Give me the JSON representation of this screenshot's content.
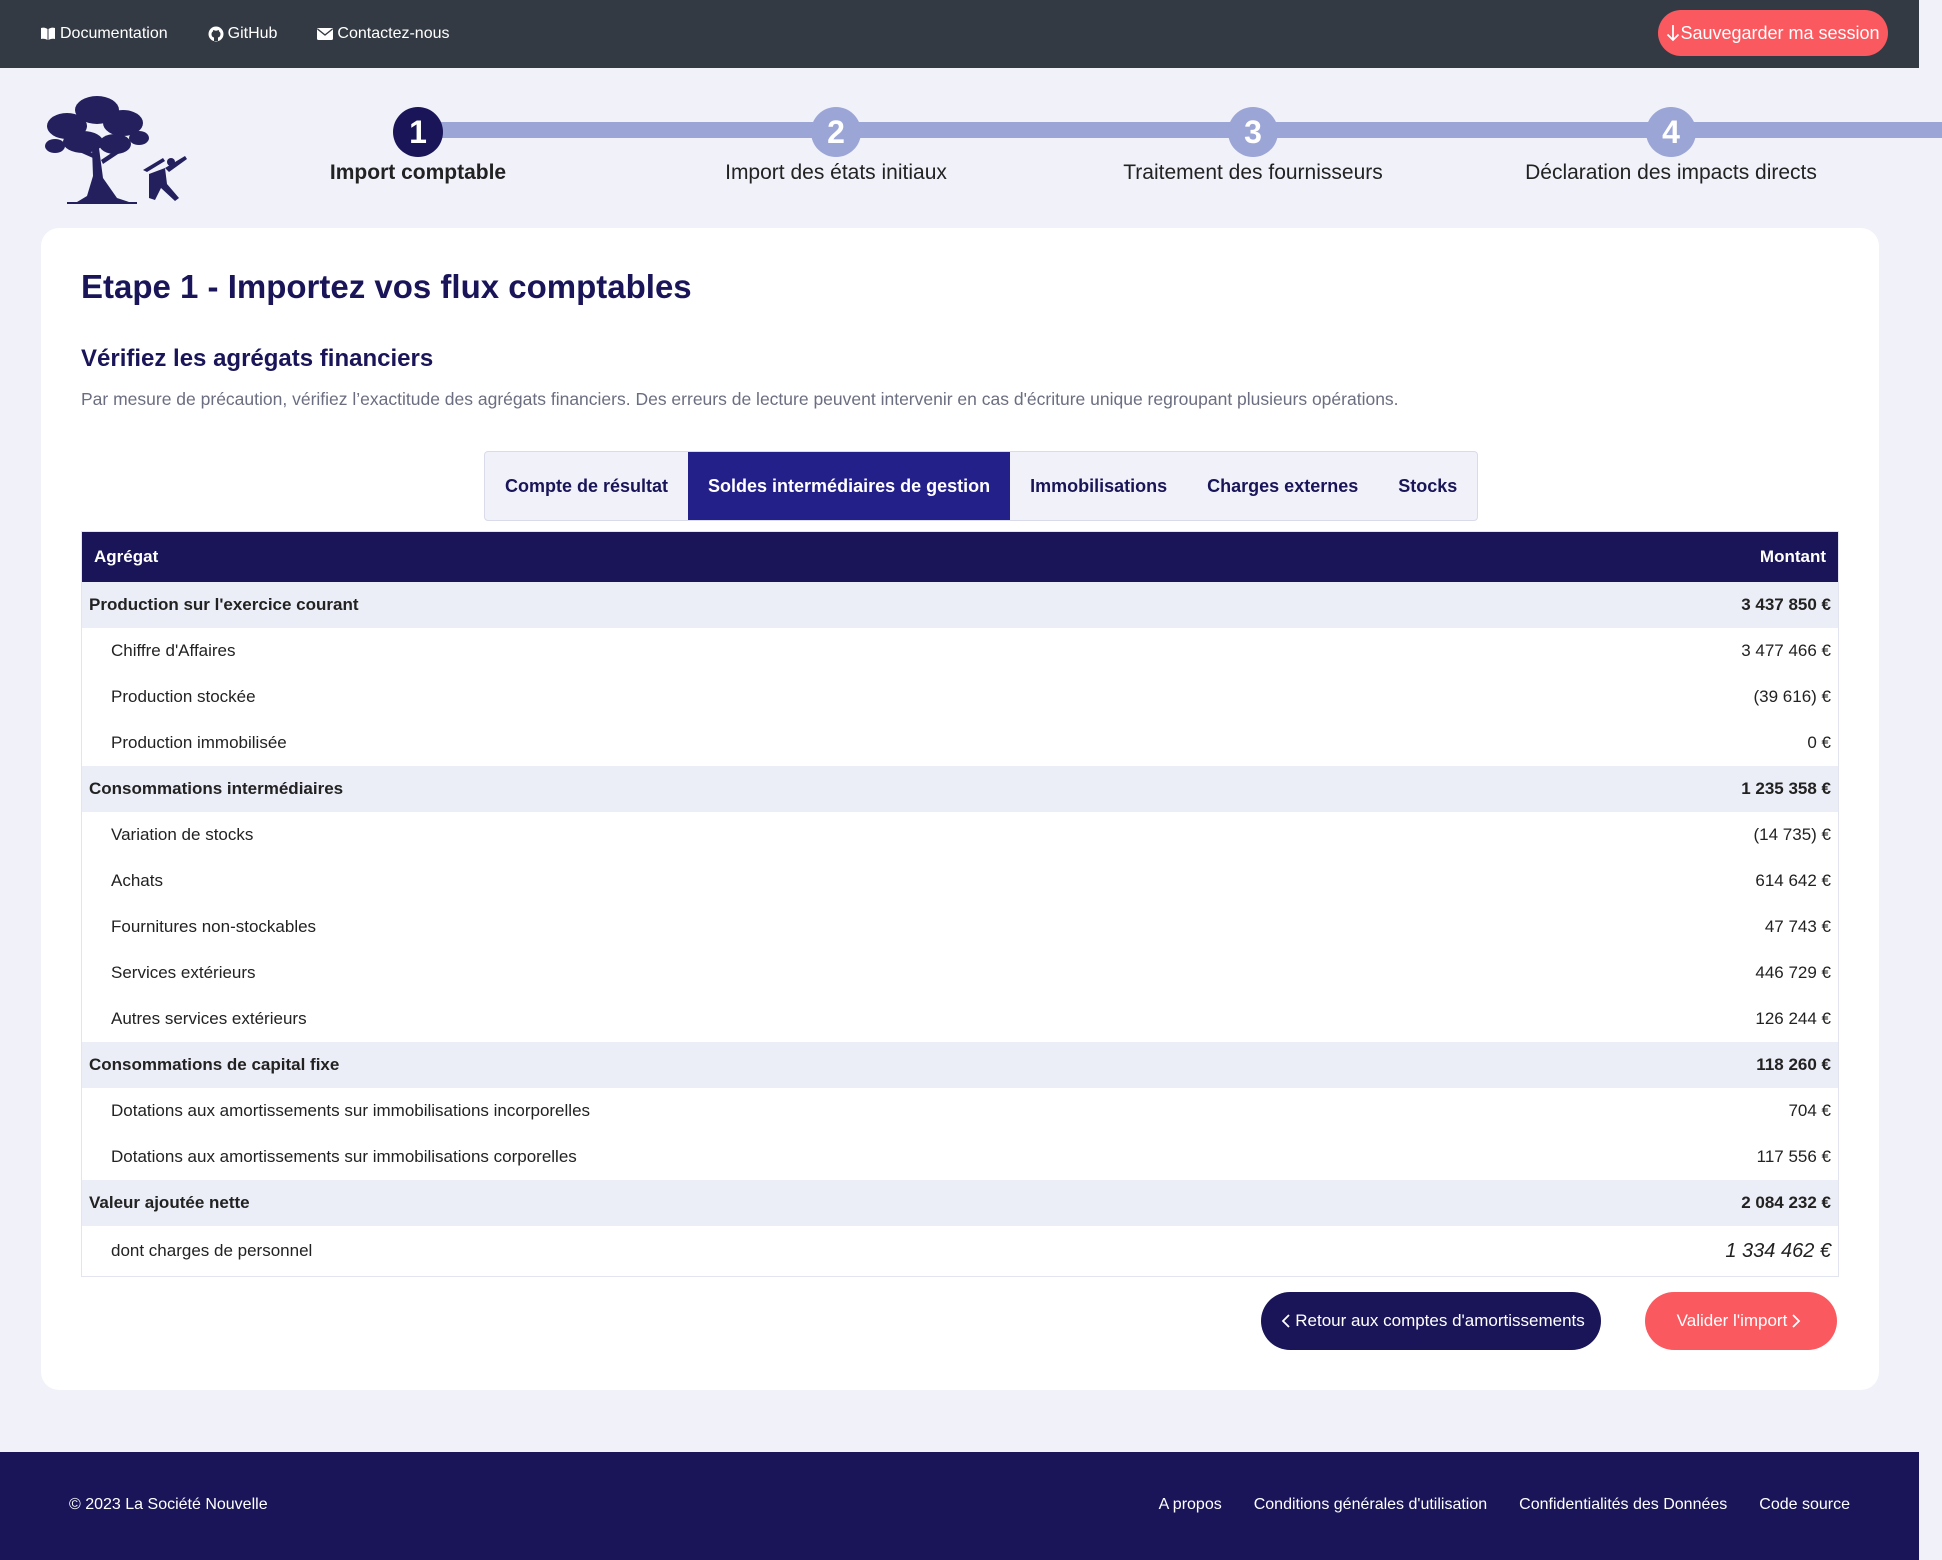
{
  "topbar": {
    "links": [
      {
        "label": "Documentation",
        "icon": "book-icon"
      },
      {
        "label": "GitHub",
        "icon": "github-icon"
      },
      {
        "label": "Contactez-nous",
        "icon": "envelope-icon"
      }
    ],
    "save_label": "Sauvegarder ma session"
  },
  "steps": [
    {
      "number": "1",
      "label": "Import comptable",
      "active": true
    },
    {
      "number": "2",
      "label": "Import des états initiaux",
      "active": false
    },
    {
      "number": "3",
      "label": "Traitement des fournisseurs",
      "active": false
    },
    {
      "number": "4",
      "label": "Déclaration des impacts directs",
      "active": false
    }
  ],
  "main": {
    "title": "Etape 1 - Importez vos flux comptables",
    "subtitle": "Vérifiez les agrégats financiers",
    "description": "Par mesure de précaution, vérifiez l’exactitude des agrégats financiers. Des erreurs de lecture peuvent intervenir en cas d'écriture unique regroupant plusieurs opérations.",
    "tabs": [
      {
        "label": "Compte de résultat",
        "active": false
      },
      {
        "label": "Soldes intermédiaires de gestion",
        "active": true
      },
      {
        "label": "Immobilisations",
        "active": false
      },
      {
        "label": "Charges externes",
        "active": false
      },
      {
        "label": "Stocks",
        "active": false
      }
    ],
    "table": {
      "headers": [
        "Agrégat",
        "Montant"
      ],
      "rows": [
        {
          "label": "Production sur l'exercice courant",
          "amount": "3 437 850 €",
          "group": true
        },
        {
          "label": "Chiffre d'Affaires",
          "amount": "3 477 466 €",
          "group": false
        },
        {
          "label": "Production stockée",
          "amount": "(39 616) €",
          "group": false
        },
        {
          "label": "Production immobilisée",
          "amount": "0 €",
          "group": false
        },
        {
          "label": "Consommations intermédiaires",
          "amount": "1 235 358 €",
          "group": true
        },
        {
          "label": "Variation de stocks",
          "amount": "(14 735) €",
          "group": false
        },
        {
          "label": "Achats",
          "amount": "614 642 €",
          "group": false
        },
        {
          "label": "Fournitures non-stockables",
          "amount": "47 743 €",
          "group": false
        },
        {
          "label": "Services extérieurs",
          "amount": "446 729 €",
          "group": false
        },
        {
          "label": "Autres services extérieurs",
          "amount": "126 244 €",
          "group": false
        },
        {
          "label": "Consommations de capital fixe",
          "amount": "118 260 €",
          "group": true
        },
        {
          "label": "Dotations aux amortissements sur immobilisations incorporelles",
          "amount": "704 €",
          "group": false
        },
        {
          "label": "Dotations aux amortissements sur immobilisations corporelles",
          "amount": "117 556 €",
          "group": false
        },
        {
          "label": "Valeur ajoutée nette",
          "amount": "2 084 232 €",
          "group": true
        },
        {
          "label": "dont charges de personnel",
          "amount": "1 334 462 €",
          "group": false,
          "italic": true
        }
      ]
    },
    "back_label": "Retour aux comptes d'amortissements",
    "validate_label": "Valider l'import"
  },
  "footer": {
    "copyright": "© 2023 La Société Nouvelle",
    "links": [
      "A propos",
      "Conditions générales d'utilisation",
      "Confidentialités des Données",
      "Code source"
    ]
  },
  "colors": {
    "navy": "#191558",
    "accent": "#fa595f",
    "step_inactive": "#9ba5d6",
    "topbar": "#343a43",
    "background": "#f0f1f9"
  }
}
